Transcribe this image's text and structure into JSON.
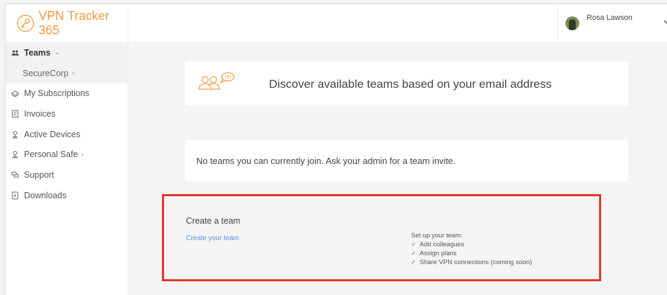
{
  "app": {
    "brand": "VPN Tracker 365"
  },
  "sidebar": {
    "items": [
      {
        "label": "Teams",
        "icon": "team-icon"
      },
      {
        "label": "SecureCorp",
        "icon": ""
      },
      {
        "label": "My Subscriptions",
        "icon": "subscriptions-icon"
      },
      {
        "label": "Invoices",
        "icon": "invoices-icon"
      },
      {
        "label": "Active Devices",
        "icon": "devices-icon"
      },
      {
        "label": "Personal Safe",
        "icon": "safe-icon"
      },
      {
        "label": "Support",
        "icon": "support-icon"
      },
      {
        "label": "Downloads",
        "icon": "downloads-icon"
      }
    ]
  },
  "header": {
    "user_name": "Rosa Lawson"
  },
  "discover": {
    "text": "Discover available teams based on your email address",
    "bubble": "Hi!"
  },
  "noteams": {
    "text": "No teams you can currently join. Ask your admin for a team invite."
  },
  "create": {
    "title": "Create a team",
    "link": "Create your team",
    "setup_title": "Set up your team:",
    "setup_items": [
      "Add colleagues",
      "Assign plans",
      "Share VPN connections (coming soon)"
    ]
  },
  "colors": {
    "brand": "#f29a3f",
    "link": "#5b8dd6",
    "highlight_border": "#e8321f"
  }
}
